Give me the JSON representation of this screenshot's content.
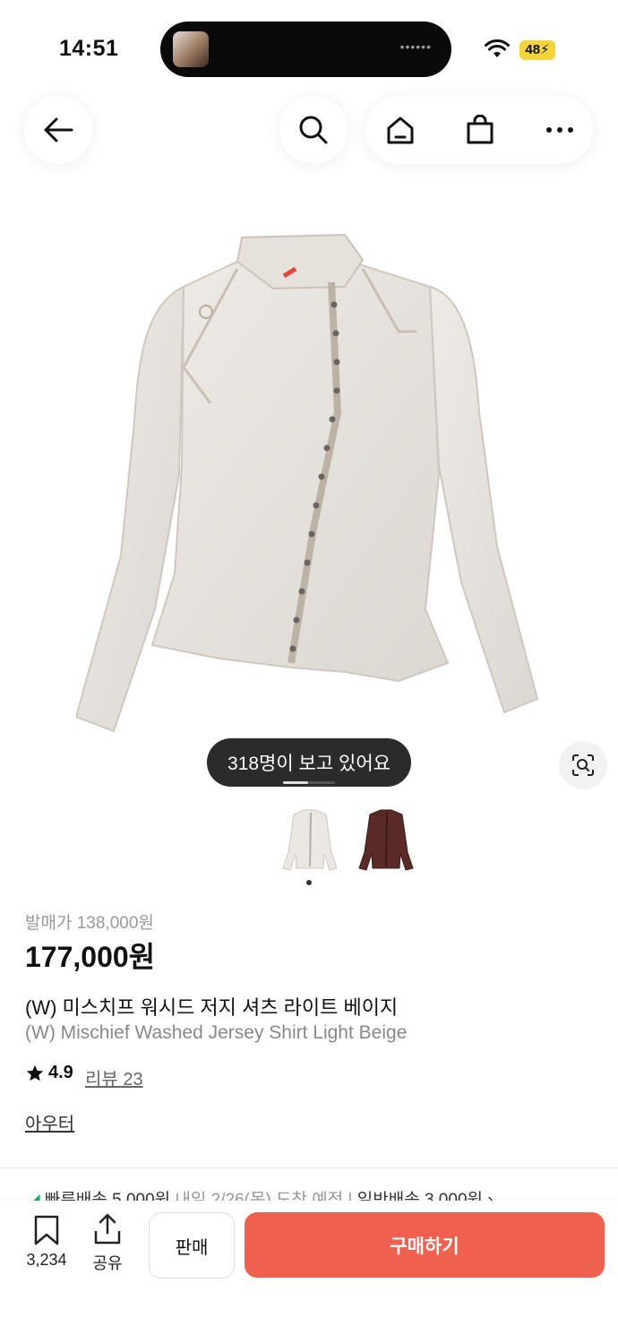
{
  "status_bar": {
    "time": "14:51",
    "battery": "48"
  },
  "nav": {
    "back_icon": "arrow-left-icon",
    "search_icon": "search-icon",
    "home_icon": "home-icon",
    "cart_icon": "shopping-bag-icon",
    "more_icon": "more-icon"
  },
  "gallery": {
    "viewers_text": "318명이 보고 있어요",
    "lens_icon": "lens-search-icon",
    "thumbnails": [
      "beige-shirt-thumbnail",
      "brown-shirt-thumbnail"
    ],
    "current_index": 1
  },
  "product": {
    "original_price": "발매가 138,000원",
    "price": "177,000원",
    "name_ko": "(W) 미스치프 워시드 저지 셔츠 라이트 베이지",
    "name_en": "(W) Mischief Washed Jersey Shirt Light Beige",
    "rating": "4.9",
    "review_text": "리뷰 23",
    "category": "아우터"
  },
  "shipping": {
    "fast_label": "빠른배송 5,000원",
    "fast_date": "내일 2/26(목) 도착 예정",
    "normal_label": "일반배송 3,000원"
  },
  "bottom_bar": {
    "bookmark_count": "3,234",
    "share_label": "공유",
    "sell_label": "판매",
    "buy_label": "구매하기"
  },
  "colors": {
    "accent": "#f0604f",
    "fast_shipping": "#17b35a"
  }
}
